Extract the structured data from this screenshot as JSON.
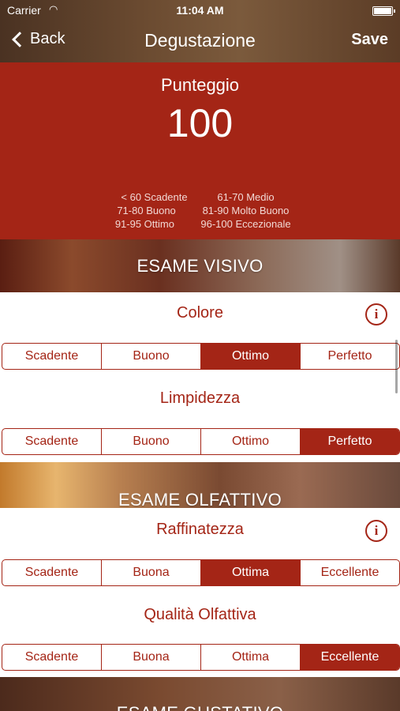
{
  "status": {
    "carrier": "Carrier",
    "time": "11:04 AM"
  },
  "nav": {
    "back_label": "Back",
    "title": "Degustazione",
    "save_label": "Save"
  },
  "score": {
    "label": "Punteggio",
    "value": "100",
    "legend": [
      [
        "< 60 Scadente",
        "61-70  Medio"
      ],
      [
        "71-80 Buono",
        "81-90 Molto Buono"
      ],
      [
        "91-95 Ottimo",
        "96-100 Eccezionale"
      ]
    ]
  },
  "sections": {
    "visivo": "ESAME VISIVO",
    "olfattivo": "ESAME OLFATTIVO",
    "gustativo": "ESAME GUSTATIVO"
  },
  "questions": {
    "colore": {
      "title": "Colore",
      "options": [
        "Scadente",
        "Buono",
        "Ottimo",
        "Perfetto"
      ],
      "selected": "Ottimo"
    },
    "limpidezza": {
      "title": "Limpidezza",
      "options": [
        "Scadente",
        "Buono",
        "Ottimo",
        "Perfetto"
      ],
      "selected": "Perfetto"
    },
    "raffinatezza": {
      "title": "Raffinatezza",
      "options": [
        "Scadente",
        "Buona",
        "Ottima",
        "Eccellente"
      ],
      "selected": "Ottima"
    },
    "qualita": {
      "title": "Qualità Olfattiva",
      "options": [
        "Scadente",
        "Buona",
        "Ottima",
        "Eccellente"
      ],
      "selected": "Eccellente"
    }
  },
  "icons": {
    "info": "i"
  },
  "colors": {
    "accent": "#a42516"
  }
}
